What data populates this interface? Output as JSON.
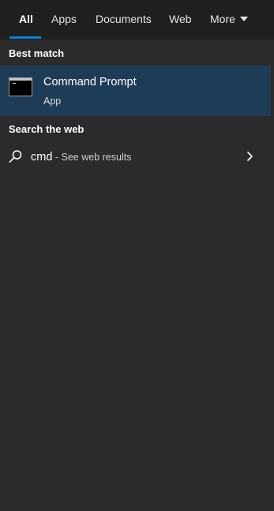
{
  "tabs": [
    {
      "label": "All",
      "active": true
    },
    {
      "label": "Apps",
      "active": false
    },
    {
      "label": "Documents",
      "active": false
    },
    {
      "label": "Web",
      "active": false
    },
    {
      "label": "More",
      "active": false
    }
  ],
  "best_match": {
    "heading": "Best match",
    "app_name": "Command Prompt",
    "app_type": "App",
    "icon": "command-prompt-icon"
  },
  "web_search": {
    "heading": "Search the web",
    "query": "cmd",
    "suffix": " - See web results",
    "icon": "search-icon",
    "action_icon": "chevron-right-icon"
  },
  "colors": {
    "tab_bar": "#1f1f1f",
    "panel": "#2b2b2b",
    "selected_row": "#1f3c56",
    "accent": "#0a84d8"
  }
}
